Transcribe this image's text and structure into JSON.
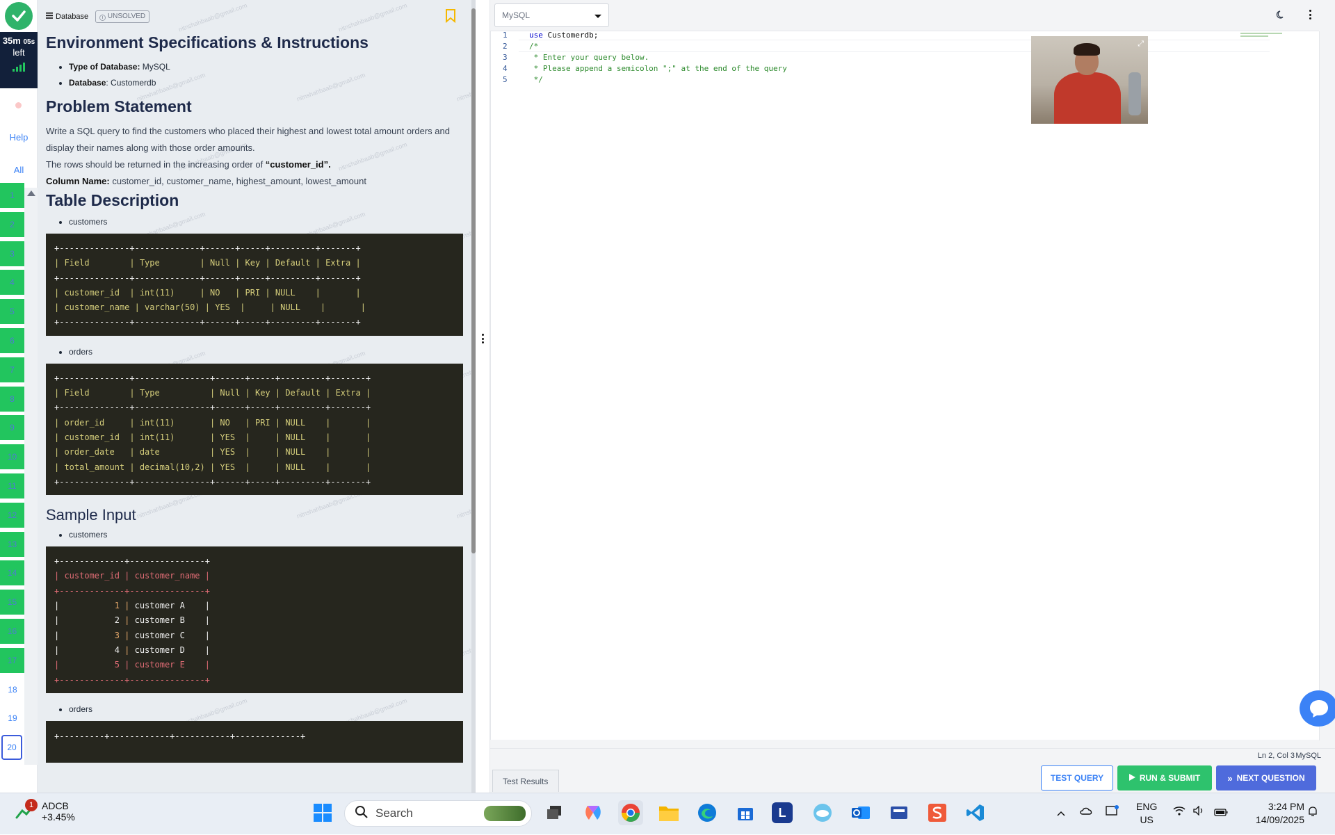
{
  "rail": {
    "timer_main": "35m",
    "timer_secs": "05s",
    "timer_left": "left",
    "help": "Help",
    "all": "All",
    "questions": [
      "1",
      "2",
      "3",
      "4",
      "5",
      "6",
      "7",
      "8",
      "9",
      "10",
      "11",
      "12",
      "13",
      "14",
      "15",
      "16",
      "17",
      "18",
      "19",
      "20"
    ],
    "answered_count": 17,
    "current": "20"
  },
  "problem": {
    "category": "Database",
    "status_badge": "UNSOLVED",
    "env_title": "Environment Specifications & Instructions",
    "env_items": [
      {
        "label": "Type of Database:",
        "value": " MySQL"
      },
      {
        "label": "Database",
        "value": ": Customerdb"
      }
    ],
    "problem_title": "Problem Statement",
    "problem_text": "Write a SQL query to find the customers who placed their highest and lowest total amount orders and display their names along with those order amounts.",
    "order_text_pre": " The rows should be returned in the increasing order of ",
    "order_text_bold": "“customer_id”.",
    "columns_label": "Column Name:",
    "columns_value": " customer_id, customer_name, highest_amount, lowest_amount",
    "table_desc_title": "Table Description",
    "table1_name": "customers",
    "table2_name": "orders",
    "sample_title": "Sample Input",
    "sample1_name": "customers",
    "sample2_name": "orders",
    "customers_schema": [
      "+--------------+-------------+------+-----+---------+-------+",
      "| Field        | Type        | Null | Key | Default | Extra |",
      "+--------------+-------------+------+-----+---------+-------+",
      "| customer_id  | int(11)     | NO   | PRI | NULL    |       |",
      "| customer_name | varchar(50) | YES  |     | NULL    |       |",
      "+--------------+-------------+------+-----+---------+-------+"
    ],
    "orders_schema": [
      "+--------------+---------------+------+-----+---------+-------+",
      "| Field        | Type          | Null | Key | Default | Extra |",
      "+--------------+---------------+------+-----+---------+-------+",
      "| order_id     | int(11)       | NO   | PRI | NULL    |       |",
      "| customer_id  | int(11)       | YES  |     | NULL    |       |",
      "| order_date   | date          | YES  |     | NULL    |       |",
      "| total_amount | decimal(10,2) | YES  |     | NULL    |       |",
      "+--------------+---------------+------+-----+---------+-------+"
    ],
    "sample_customers": {
      "border": "+-------------+---------------+",
      "header": "| customer_id | customer_name |",
      "rows": [
        {
          "id": "1",
          "name": "customer A"
        },
        {
          "id": "2",
          "name": "customer B"
        },
        {
          "id": "3",
          "name": "customer C"
        },
        {
          "id": "4",
          "name": "customer D"
        },
        {
          "id": "5",
          "name": "customer E"
        }
      ]
    },
    "sample_orders_border": "+---------+------------+-----------+-------------+",
    "watermark": "nitnshahbaab@gmail.com"
  },
  "editor": {
    "language": "MySQL",
    "code_lines": [
      {
        "n": "1",
        "parts": [
          {
            "c": "kw",
            "t": "use"
          },
          {
            "c": "plain",
            "t": " Customerdb;"
          }
        ]
      },
      {
        "n": "2",
        "parts": [
          {
            "c": "cm",
            "t": "/*"
          }
        ]
      },
      {
        "n": "3",
        "parts": [
          {
            "c": "cm",
            "t": " * Enter your query below."
          }
        ]
      },
      {
        "n": "4",
        "parts": [
          {
            "c": "cm",
            "t": " * Please append a semicolon \";\" at the end of the query"
          }
        ]
      },
      {
        "n": "5",
        "parts": [
          {
            "c": "cm",
            "t": " */"
          }
        ]
      }
    ],
    "cursor_pos": "Ln 2, Col 3",
    "status_lang": "MySQL",
    "results_tab": "Test Results",
    "btn_test": "TEST QUERY",
    "btn_run": "RUN & SUBMIT",
    "btn_next": "NEXT QUESTION"
  },
  "taskbar": {
    "stock_name": "ADCB",
    "stock_change": "+3.45%",
    "notification_count": "1",
    "search_placeholder": "Search",
    "lang_top": "ENG",
    "lang_bottom": "US",
    "time": "3:24 PM",
    "date": "14/09/2025"
  },
  "colors": {
    "accent_green": "#22c55e",
    "accent_blue": "#3b82f6",
    "panel_bg": "#e9edf1",
    "code_bg": "#26261e"
  }
}
